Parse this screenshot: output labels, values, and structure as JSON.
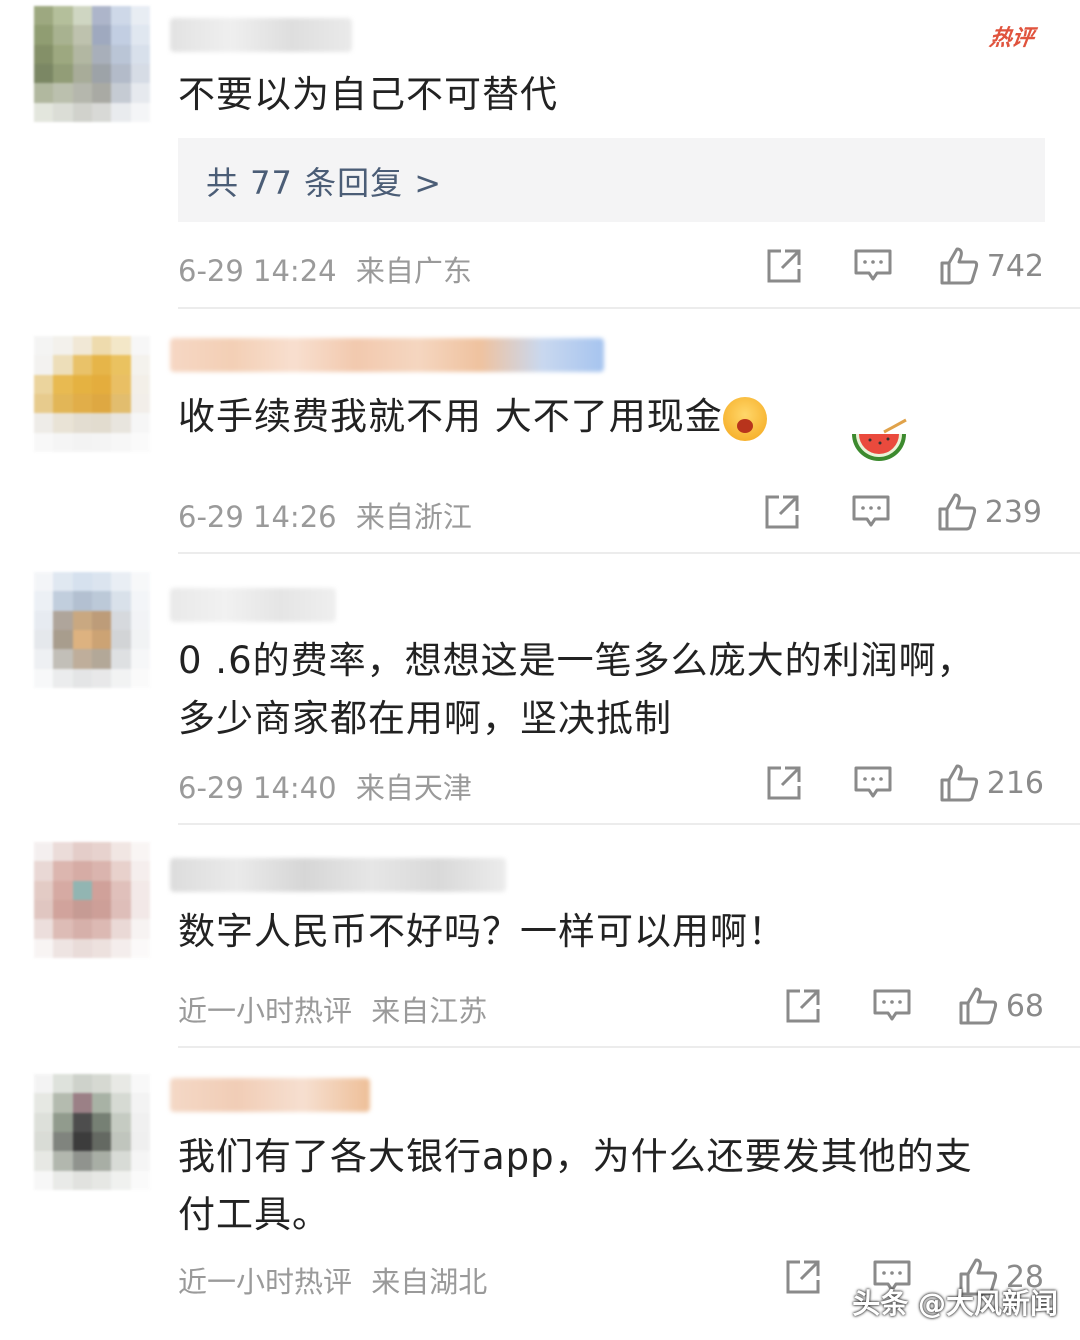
{
  "hot_badge": "热评",
  "comments": [
    {
      "text": "不要以为自己不可替代",
      "replies_label": "共 77 条回复 >",
      "time": "6-29 14:24",
      "location": "来自广东",
      "likes": "742"
    },
    {
      "text": "收手续费我就不用 大不了用现金",
      "time": "6-29 14:26",
      "location": "来自浙江",
      "likes": "239",
      "emoji_icons": [
        "yawning-face-icon",
        "watermelon-icon"
      ]
    },
    {
      "text_line1": "0 .6的费率，想想这是一笔多么庞大的利润啊，",
      "text_line2": "多少商家都在用啊，坚决抵制",
      "time": "6-29 14:40",
      "location": "来自天津",
      "likes": "216"
    },
    {
      "text": "数字人民币不好吗？一样可以用啊！",
      "time": "近一小时热评",
      "location": "来自江苏",
      "likes": "68"
    },
    {
      "text_line1": "我们有了各大银行app，为什么还要发其他的支",
      "text_line2": "付工具。",
      "time": "近一小时热评",
      "location": "来自湖北",
      "likes": "28"
    }
  ],
  "watermark": "头条 @大风新闻",
  "colors": {
    "accent_reply": "#4b5d76",
    "meta": "#9a9a9a",
    "hot": "#e0533d"
  }
}
